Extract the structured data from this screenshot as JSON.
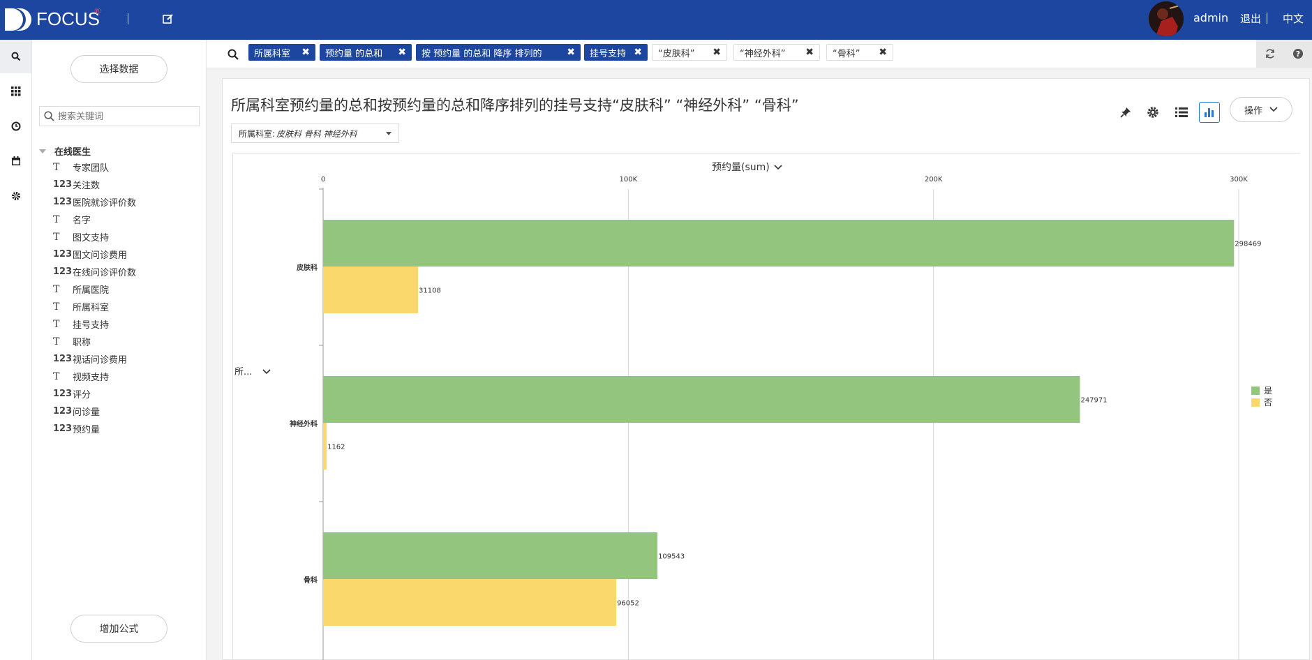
{
  "app": {
    "brand": "FOCUS",
    "brand_mark": "®"
  },
  "header": {
    "user": "admin",
    "logout": "退出",
    "language": "中文"
  },
  "rail": {
    "icons": [
      "search-icon",
      "grid-icon",
      "clock-icon",
      "calendar-icon",
      "gear-icon"
    ]
  },
  "panel": {
    "select_data": "选择数据",
    "search_placeholder": "搜索关键词",
    "root": "在线医生",
    "fields": [
      {
        "type": "T",
        "label": "专家团队"
      },
      {
        "type": "123",
        "label": "关注数"
      },
      {
        "type": "123",
        "label": "医院就诊评价数"
      },
      {
        "type": "T",
        "label": "名字"
      },
      {
        "type": "T",
        "label": "图文支持"
      },
      {
        "type": "123",
        "label": "图文问诊费用"
      },
      {
        "type": "123",
        "label": "在线问诊评价数"
      },
      {
        "type": "T",
        "label": "所属医院"
      },
      {
        "type": "T",
        "label": "所属科室"
      },
      {
        "type": "T",
        "label": "挂号支持"
      },
      {
        "type": "T",
        "label": "职称"
      },
      {
        "type": "123",
        "label": "视话问诊费用"
      },
      {
        "type": "T",
        "label": "视频支持"
      },
      {
        "type": "123",
        "label": "评分"
      },
      {
        "type": "123",
        "label": "问诊量"
      },
      {
        "type": "123",
        "label": "预约量"
      }
    ],
    "add_formula": "增加公式"
  },
  "query": {
    "chips": [
      {
        "label": "所属科室",
        "style": "dark"
      },
      {
        "label": "预约量 的总和",
        "style": "dark"
      },
      {
        "label": "按 预约量 的总和 降序 排列的",
        "style": "dark"
      },
      {
        "label": "挂号支持",
        "style": "dark"
      },
      {
        "label": "“皮肤科”",
        "style": "light"
      },
      {
        "label": "“神经外科”",
        "style": "light"
      },
      {
        "label": "“骨科”",
        "style": "light"
      }
    ],
    "remove_glyph": "✖"
  },
  "main": {
    "title": "所属科室预约量的总和按预约量的总和降序排列的挂号支持“皮肤科” “神经外科” “骨科”",
    "filter_label": "所属科室:",
    "filter_values": "皮肤科  骨科  神经外科",
    "operate": "操作",
    "toolbar_icons": [
      "pin-icon",
      "gear-icon",
      "list-icon",
      "bar-chart-icon"
    ]
  },
  "chart_data": {
    "type": "bar",
    "orientation": "horizontal",
    "xlabel": "预约量(sum)",
    "ylabel": "所...",
    "categories": [
      "皮肤科",
      "神经外科",
      "骨科"
    ],
    "xlim": [
      0,
      300000
    ],
    "xticks": [
      0,
      100000,
      200000,
      300000
    ],
    "xtick_labels": [
      "0",
      "100K",
      "200K",
      "300K"
    ],
    "grid": true,
    "legend_position": "right",
    "series": [
      {
        "name": "是",
        "color": "#94c57e",
        "values": [
          298469,
          247971,
          109543
        ]
      },
      {
        "name": "否",
        "color": "#fbd86c",
        "values": [
          31108,
          1162,
          96052
        ]
      }
    ]
  }
}
